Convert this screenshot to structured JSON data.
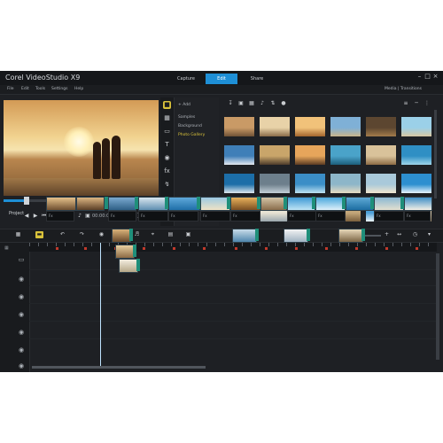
{
  "app": {
    "title": "Corel VideoStudio X9"
  },
  "steps": [
    {
      "label": "Capture",
      "active": false
    },
    {
      "label": "Edit",
      "active": true
    },
    {
      "label": "Share",
      "active": false
    }
  ],
  "window_controls": [
    "minimize",
    "maximize",
    "close"
  ],
  "menu": {
    "items": [
      "File",
      "Edit",
      "Tools",
      "Settings",
      "Help"
    ],
    "right_text": "Media | Transitions"
  },
  "preview": {
    "mode_label": "Project",
    "timecode": "00:00:00:00",
    "progress": 0.15,
    "controls": [
      "home-icon",
      "play-icon",
      "prev-frame-icon",
      "next-frame-icon",
      "end-icon",
      "repeat-icon",
      "volume-icon",
      "fit-icon"
    ]
  },
  "library": {
    "side_icons": [
      "media-icon",
      "instant-project-icon",
      "transition-icon",
      "title-icon",
      "graphic-icon",
      "filter-icon",
      "path-icon"
    ],
    "folders": [
      "Samples",
      "Background",
      "Photo Gallery"
    ],
    "selected_folder": 2,
    "add_label": "Add",
    "thumbs": [
      [
        "hammock",
        "pier",
        "beach-chair",
        "tropical",
        "palm",
        "lagoon"
      ],
      [
        "sailboat",
        "shell",
        "sunset",
        "reef",
        "dunes",
        "island"
      ],
      [
        "surf",
        "cliff",
        "sea",
        "shore",
        "bay",
        "waves"
      ],
      [
        "sky",
        "ocean",
        "coast",
        "deck",
        "sand",
        "horizon"
      ]
    ]
  },
  "timeline": {
    "tools": [
      "storyboard-icon",
      "timeline-icon",
      "undo-icon",
      "redo-icon",
      "record-icon",
      "sound-mixer-icon",
      "auto-music-icon",
      "motion-tracking-icon",
      "subtitle-icon",
      "multi-camera-icon",
      "zoom-out-icon",
      "zoom-slider",
      "zoom-in-icon",
      "fit-project-icon",
      "timecode"
    ],
    "zoom_level": 0.35,
    "tracks": [
      {
        "name": "video-track",
        "icon": "film-icon"
      },
      {
        "name": "overlay-track-1",
        "icon": "overlay-icon"
      },
      {
        "name": "overlay-track-2",
        "icon": "overlay-icon"
      },
      {
        "name": "overlay-track-3",
        "icon": "overlay-icon"
      },
      {
        "name": "title-track",
        "icon": "title-icon"
      },
      {
        "name": "voice-track",
        "icon": "mic-icon"
      },
      {
        "name": "music-track",
        "icon": "music-icon"
      }
    ],
    "audio_clip_label": "Fx"
  },
  "colors": {
    "accent": "#1e8fd6",
    "highlight": "#d9c23b",
    "clip": "#1f8f7a"
  }
}
